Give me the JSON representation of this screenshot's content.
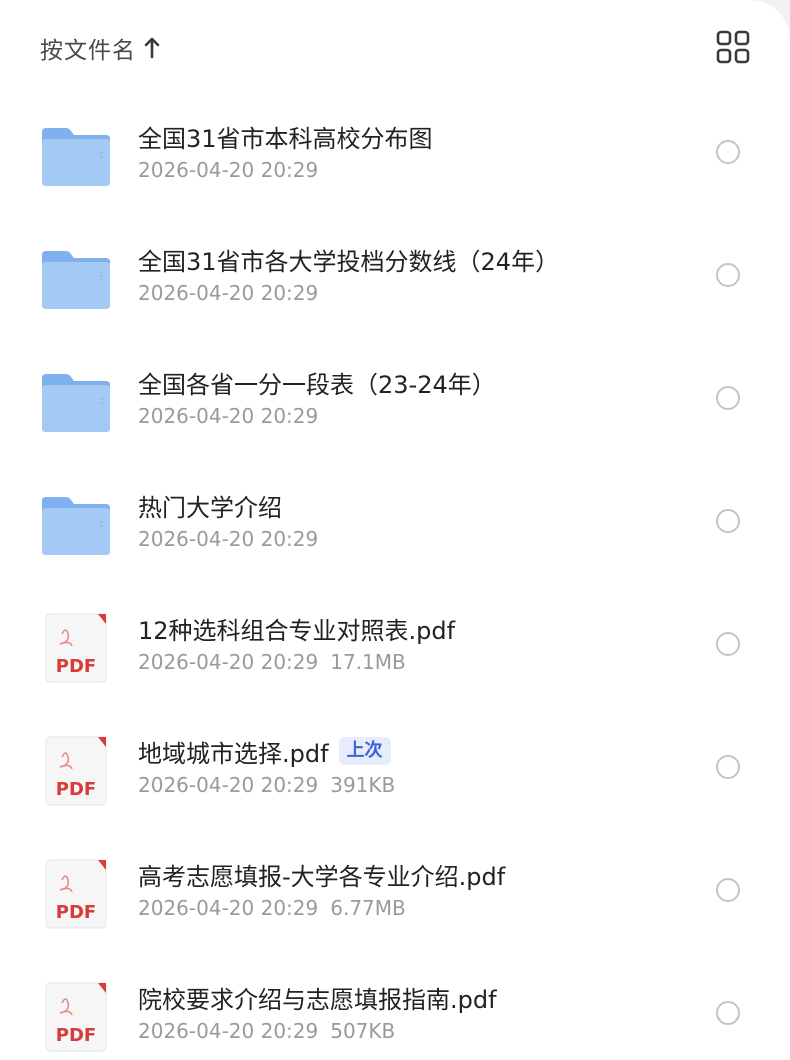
{
  "sort": {
    "label": "按文件名",
    "arrow_icon": "arrow-up-icon"
  },
  "view_toggle_icon": "grid-view-icon",
  "colors": {
    "folder": "#7fb1ee",
    "pdf_red": "#d93a3a",
    "badge_bg": "#e6ecfc",
    "badge_text": "#3b63d6"
  },
  "files": [
    {
      "name": "全国31省市本科高校分布图",
      "date": "2026-04-20 20:29",
      "size": "",
      "type": "folder",
      "badge": ""
    },
    {
      "name": "全国31省市各大学投档分数线（24年）",
      "date": "2026-04-20 20:29",
      "size": "",
      "type": "folder",
      "badge": ""
    },
    {
      "name": "全国各省一分一段表（23-24年）",
      "date": "2026-04-20 20:29",
      "size": "",
      "type": "folder",
      "badge": ""
    },
    {
      "name": "热门大学介绍",
      "date": "2026-04-20 20:29",
      "size": "",
      "type": "folder",
      "badge": ""
    },
    {
      "name": "12种选科组合专业对照表.pdf",
      "date": "2026-04-20 20:29",
      "size": "17.1MB",
      "type": "pdf",
      "badge": ""
    },
    {
      "name": "地域城市选择.pdf",
      "date": "2026-04-20 20:29",
      "size": "391KB",
      "type": "pdf",
      "badge": "上次"
    },
    {
      "name": "高考志愿填报-大学各专业介绍.pdf",
      "date": "2026-04-20 20:29",
      "size": "6.77MB",
      "type": "pdf",
      "badge": ""
    },
    {
      "name": "院校要求介绍与志愿填报指南.pdf",
      "date": "2026-04-20 20:29",
      "size": "507KB",
      "type": "pdf",
      "badge": ""
    }
  ],
  "pdf_icon_label": "PDF"
}
